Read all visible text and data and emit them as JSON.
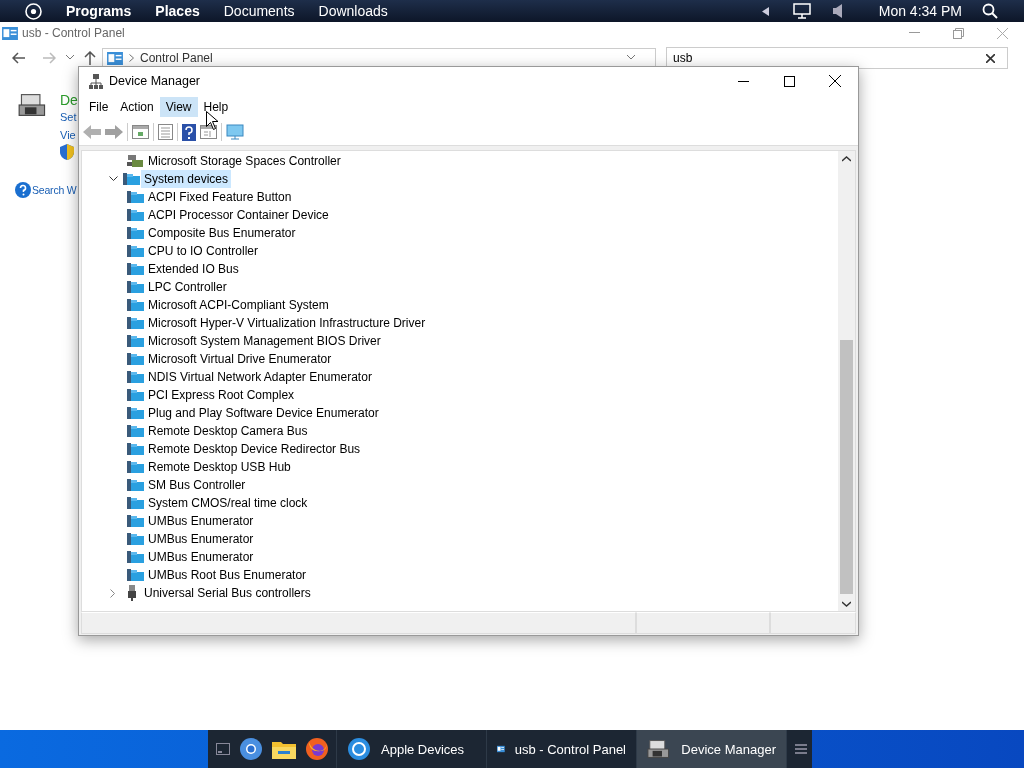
{
  "top_bar": {
    "menus": [
      {
        "label": "Programs",
        "bold": true
      },
      {
        "label": "Places",
        "bold": true
      },
      {
        "label": "Documents",
        "bold": false
      },
      {
        "label": "Downloads",
        "bold": false
      }
    ],
    "clock": "Mon 4:34 PM"
  },
  "control_panel": {
    "title": "usb - Control Panel",
    "address": "Control Panel",
    "search": {
      "value": "usb"
    },
    "heading": "De",
    "links": [
      "Set",
      "Vie"
    ],
    "help_link": "Search W"
  },
  "device_manager": {
    "title": "Device Manager",
    "menu": [
      {
        "label": "File",
        "hovered": false
      },
      {
        "label": "Action",
        "hovered": false
      },
      {
        "label": "View",
        "hovered": true
      },
      {
        "label": "Help",
        "hovered": false
      }
    ],
    "tree": [
      {
        "children": [
          {
            "label": "Microsoft Storage Spaces Controller",
            "kind": "storage"
          }
        ]
      },
      {
        "label": "System devices",
        "kind": "system",
        "expanded": true,
        "selected": true,
        "children": [
          {
            "label": "ACPI Fixed Feature Button",
            "kind": "system"
          },
          {
            "label": "ACPI Processor Container Device",
            "kind": "system"
          },
          {
            "label": "Composite Bus Enumerator",
            "kind": "system"
          },
          {
            "label": "CPU to IO Controller",
            "kind": "system"
          },
          {
            "label": "Extended IO Bus",
            "kind": "system"
          },
          {
            "label": "LPC Controller",
            "kind": "system"
          },
          {
            "label": "Microsoft ACPI-Compliant System",
            "kind": "system"
          },
          {
            "label": "Microsoft Hyper-V Virtualization Infrastructure Driver",
            "kind": "system"
          },
          {
            "label": "Microsoft System Management BIOS Driver",
            "kind": "system"
          },
          {
            "label": "Microsoft Virtual Drive Enumerator",
            "kind": "system"
          },
          {
            "label": "NDIS Virtual Network Adapter Enumerator",
            "kind": "system"
          },
          {
            "label": "PCI Express Root Complex",
            "kind": "system"
          },
          {
            "label": "Plug and Play Software Device Enumerator",
            "kind": "system"
          },
          {
            "label": "Remote Desktop Camera Bus",
            "kind": "system"
          },
          {
            "label": "Remote Desktop Device Redirector Bus",
            "kind": "system"
          },
          {
            "label": "Remote Desktop USB Hub",
            "kind": "system"
          },
          {
            "label": "SM Bus Controller",
            "kind": "system"
          },
          {
            "label": "System CMOS/real time clock",
            "kind": "system"
          },
          {
            "label": "UMBus Enumerator",
            "kind": "system"
          },
          {
            "label": "UMBus Enumerator",
            "kind": "system"
          },
          {
            "label": "UMBus Enumerator",
            "kind": "system"
          },
          {
            "label": "UMBus Root Bus Enumerator",
            "kind": "system"
          }
        ]
      },
      {
        "label": "Universal Serial Bus controllers",
        "kind": "usb",
        "expanded": false,
        "selected": false
      }
    ]
  },
  "taskbar": {
    "buttons": [
      {
        "label": "Apple Devices",
        "kind": "sync",
        "active": false
      },
      {
        "label": "usb - Control Panel",
        "kind": "control-panel",
        "active": false
      },
      {
        "label": "Device Manager",
        "kind": "device-manager",
        "active": true
      }
    ]
  }
}
